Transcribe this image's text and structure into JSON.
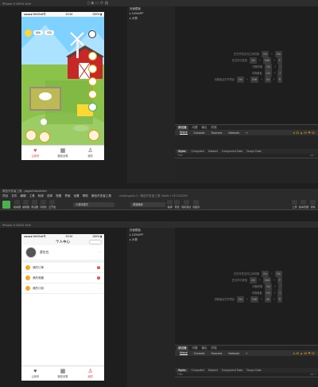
{
  "top_window": {
    "device_label": "iPhone 5 100% 16 ▾",
    "phone_status": {
      "carrier": "●●●●● WeChat令",
      "time": "22:34",
      "battery": "100% ▮"
    },
    "game_pills": [
      "我的",
      "背包"
    ],
    "tabbar": [
      {
        "icon": "♥",
        "label": "让我来"
      },
      {
        "icon": "▦",
        "label": "播放设置"
      },
      {
        "icon": "♙",
        "label": "我的"
      }
    ],
    "tree_header": "页面模板",
    "tree_items": [
      "▸ 1000APP",
      "▸ 大物"
    ],
    "shortcuts": [
      {
        "label": "在打开的文件之间切换",
        "keys": [
          "Ctrl",
          "+",
          "Tab"
        ]
      },
      {
        "label": "在文件中查找",
        "keys": [
          "Ctrl",
          "+",
          "Shift",
          "+",
          "F"
        ]
      },
      {
        "label": "切换终端",
        "keys": [
          "Ctrl",
          "+",
          "`"
        ]
      },
      {
        "label": "切换面板",
        "keys": [
          "Ctrl",
          "+",
          "J"
        ]
      },
      {
        "label": "切换最近打开项目",
        "keys": [
          "Ctrl",
          "+",
          "Shift",
          "+",
          "Alt",
          "+",
          "R"
        ]
      }
    ],
    "debug_tabs": [
      "调试器",
      "问题",
      "输出",
      "终端"
    ],
    "devtools_tabs": [
      "Wxml",
      "Console",
      "Sources",
      "Network",
      "»"
    ],
    "counters": "● 25 ▲ 29 ⚑ 52",
    "styles_tabs": [
      "Styles",
      "Computed",
      "Dataset",
      "Component Data",
      "Scope Data"
    ],
    "filter_placeholder": "Filter",
    "filter_right": ".cls +"
  },
  "bottom_window": {
    "title_path": "微信开发者工具 - pages/index/index",
    "menu": [
      "项目",
      "文件",
      "编辑",
      "工具",
      "转到",
      "选择",
      "视图",
      "界面",
      "设置",
      "帮助",
      "微信开发者工具"
    ],
    "crumb": "miniprogram-3 - 微信开发者工具 Stable 1.05.2204250",
    "toolbar_left": [
      {
        "label": "模拟器"
      },
      {
        "label": "编辑器"
      },
      {
        "label": "调试器"
      },
      {
        "label": "可视化"
      },
      {
        "label": "云开发"
      }
    ],
    "mode_select": "小程序模式",
    "compile_select": "普通编译",
    "toolbar_mid": [
      {
        "label": "编译"
      },
      {
        "label": "预览"
      },
      {
        "label": "真机调试"
      },
      {
        "label": "清缓存"
      }
    ],
    "toolbar_right": [
      {
        "label": "上传"
      },
      {
        "label": "版本管理"
      },
      {
        "label": "详情"
      }
    ],
    "device_label": "iPhone 5 100% 16 ▾",
    "phone_status": {
      "carrier": "●●●●● WeChat令",
      "time": "22:34",
      "battery": "100% ▮"
    },
    "nav_title": "个人中心",
    "user_name": "赛包包",
    "menu_items": [
      {
        "label": "我的订单",
        "color": "#f5a623",
        "badge": "5"
      },
      {
        "label": "我的收藏",
        "color": "#f5a623",
        "badge": "2"
      },
      {
        "label": "我的订阅",
        "color": "#f5a623",
        "badge": ""
      }
    ],
    "tabbar": [
      {
        "icon": "♥",
        "label": "让我来"
      },
      {
        "icon": "▦",
        "label": "播放设置"
      },
      {
        "icon": "♙",
        "label": "我的"
      }
    ],
    "tree_header": "页面模板",
    "tree_items": [
      "▸ 1000APP",
      "▸ 大物"
    ],
    "shortcuts": [
      {
        "label": "在打开的文件之间切换",
        "keys": [
          "Ctrl",
          "+",
          "Tab"
        ]
      },
      {
        "label": "在文件中查找",
        "keys": [
          "Ctrl",
          "+",
          "Shift",
          "+",
          "F"
        ]
      },
      {
        "label": "切换终端",
        "keys": [
          "Ctrl",
          "+",
          "`"
        ]
      },
      {
        "label": "切换面板",
        "keys": [
          "Ctrl",
          "+",
          "J"
        ]
      },
      {
        "label": "切换最近打开项目",
        "keys": [
          "Ctrl",
          "+",
          "Shift",
          "+",
          "Alt",
          "+",
          "R"
        ]
      }
    ],
    "debug_tabs": [
      "调试器",
      "问题",
      "输出",
      "终端"
    ],
    "devtools_tabs": [
      "Wxml",
      "Console",
      "Sources",
      "Network",
      "»"
    ],
    "counters": "● 26 ▲ 38 ⚑ 52",
    "styles_tabs": [
      "Styles",
      "Computed",
      "Dataset",
      "Component Data",
      "Scope Data"
    ],
    "filter_placeholder": "Filter",
    "filter_right": ".cls +"
  },
  "colors": {
    "accent": "#e64340",
    "sky": "#6ec6ff",
    "grass": "#8bc34a",
    "barn": "#c62828"
  }
}
